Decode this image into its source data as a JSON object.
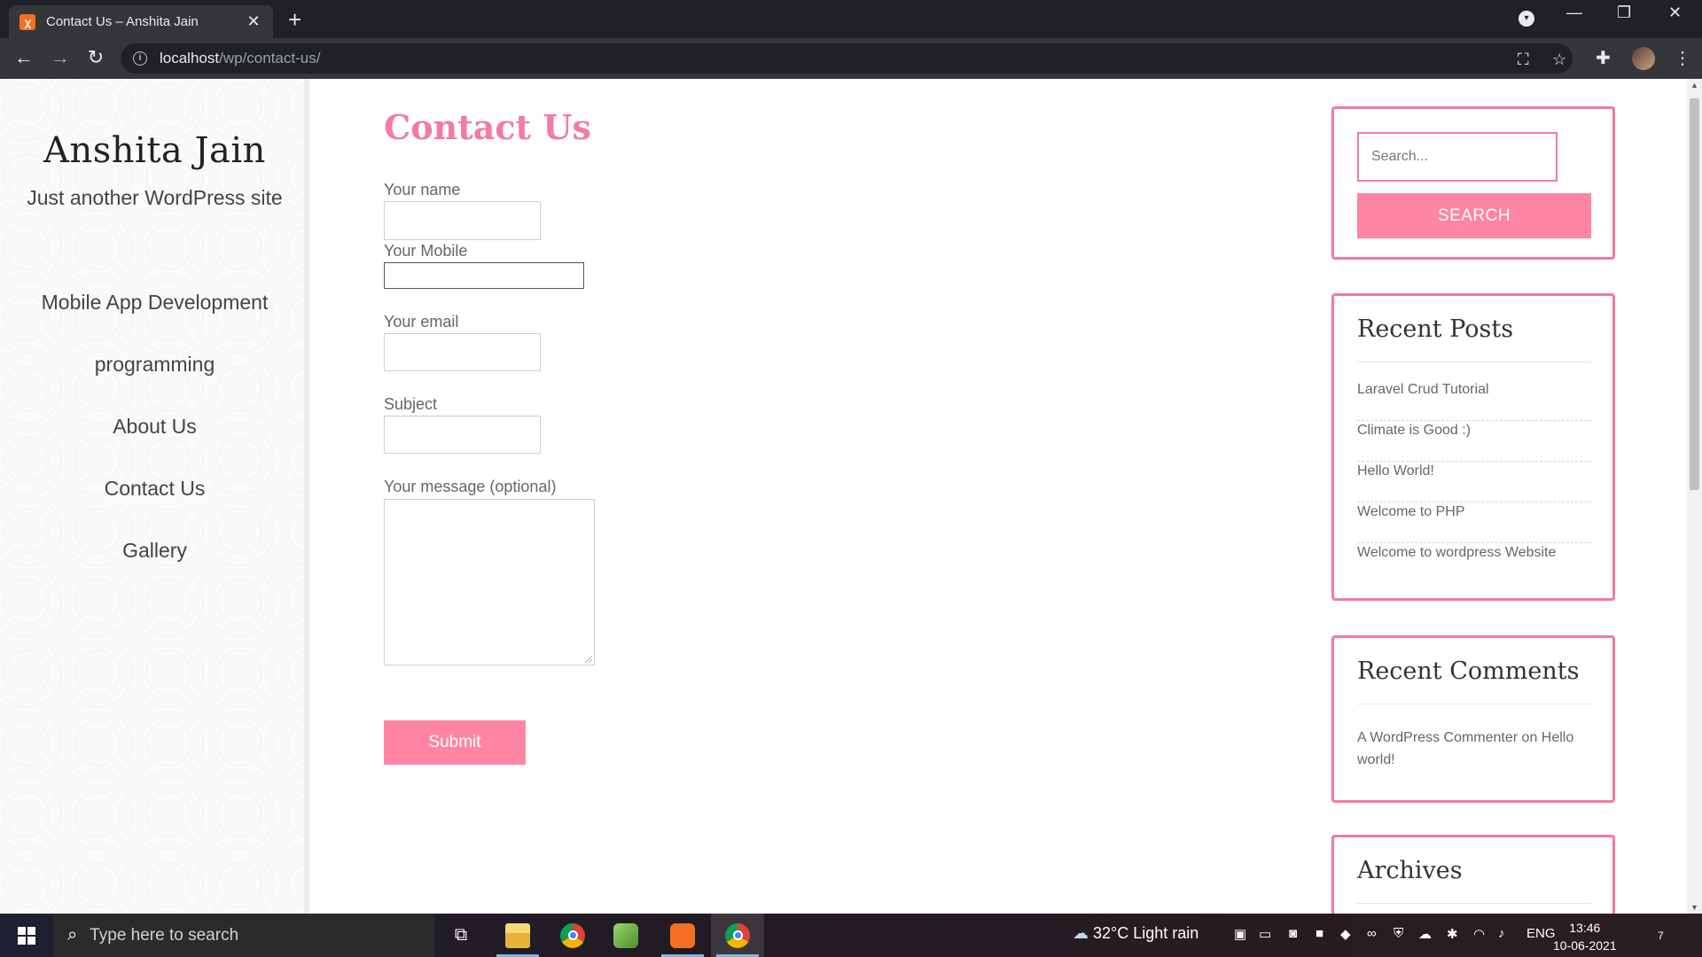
{
  "browser": {
    "tab_title": "Contact Us – Anshita Jain",
    "url_host": "localhost",
    "url_path": "/wp/contact-us/"
  },
  "site": {
    "title": "Anshita Jain",
    "tagline": "Just another WordPress site",
    "menu": [
      "Mobile App Development",
      "programming",
      "About Us",
      "Contact Us",
      "Gallery"
    ]
  },
  "form": {
    "page_title": "Contact Us",
    "name_label": "Your name",
    "mobile_label": "Your Mobile",
    "email_label": "Your email",
    "subject_label": "Subject",
    "message_label": "Your message (optional)",
    "submit_label": "Submit"
  },
  "sidebar": {
    "search_placeholder": "Search...",
    "search_button": "SEARCH",
    "recent_posts_title": "Recent Posts",
    "recent_posts": [
      "Laravel Crud Tutorial",
      "Climate is Good :)",
      "Hello World!",
      "Welcome to PHP",
      "Welcome to wordpress Website"
    ],
    "recent_comments_title": "Recent Comments",
    "comment_author": "A WordPress Commenter",
    "comment_on": "on",
    "comment_post": "Hello world!",
    "archives_title": "Archives"
  },
  "taskbar": {
    "search_placeholder": "Type here to search",
    "weather": "32°C  Light rain",
    "language": "ENG",
    "time": "13:46",
    "date": "10-06-2021",
    "notification_count": "7"
  },
  "colors": {
    "accent": "#f37b9d",
    "button": "#ff85a2"
  }
}
